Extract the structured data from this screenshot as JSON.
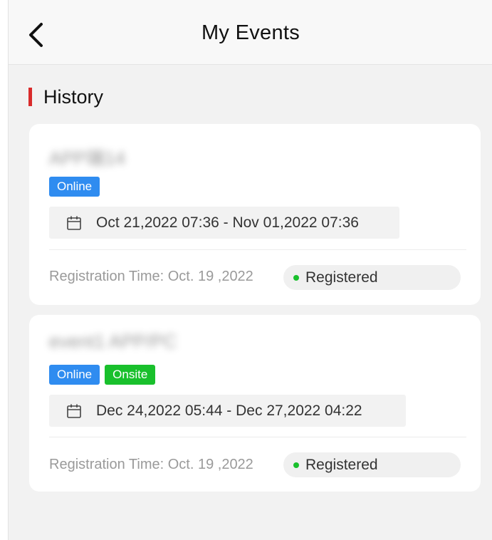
{
  "header": {
    "title": "My Events",
    "back_icon": "chevron-left-icon"
  },
  "section": {
    "title": "History",
    "accent_color": "#d92b2b"
  },
  "events": [
    {
      "title": "APP端14",
      "tags": [
        "Online"
      ],
      "date_range": "Oct 21,2022 07:36  - Nov 01,2022 07:36",
      "registration_time": "Registration Time: Oct. 19 ,2022",
      "status": "Registered"
    },
    {
      "title": "event1 APP/PC",
      "tags": [
        "Online",
        "Onsite"
      ],
      "date_range": "Dec 24,2022 05:44  - Dec 27,2022 04:22",
      "registration_time": "Registration Time: Oct. 19 ,2022",
      "status": "Registered"
    }
  ],
  "colors": {
    "online_tag": "#2f8cf0",
    "onsite_tag": "#19c02c",
    "status_dot": "#19c02c"
  }
}
